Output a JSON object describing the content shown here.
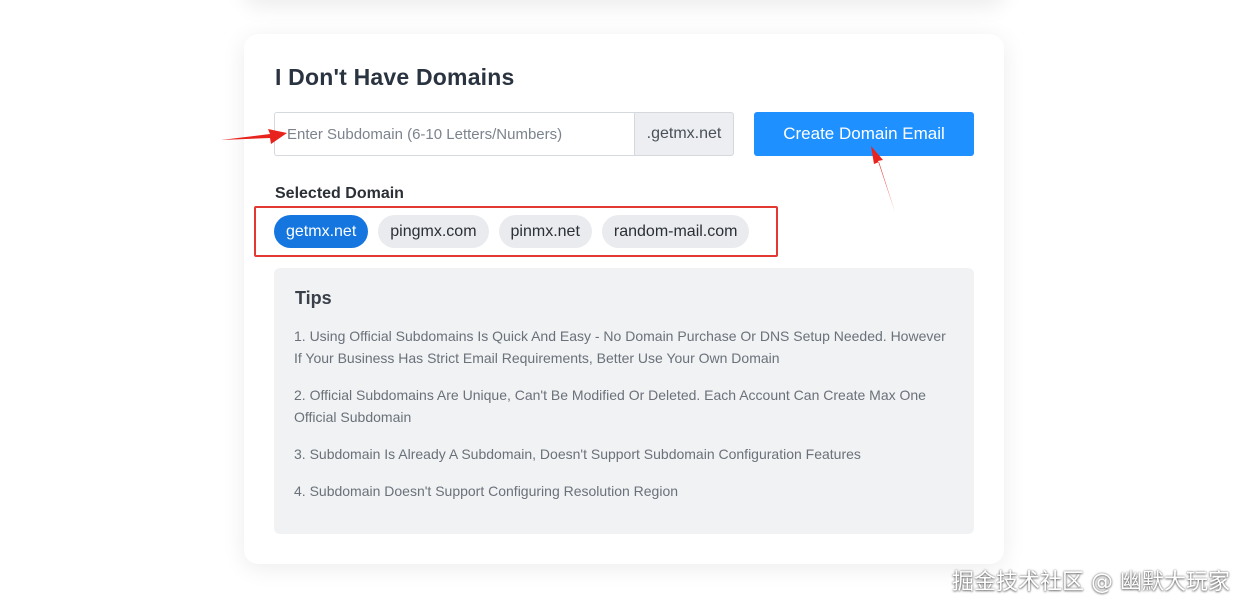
{
  "section": {
    "title": "I Don't Have Domains"
  },
  "subdomain_input": {
    "placeholder": "Enter Subdomain (6-10 Letters/Numbers)",
    "value": "",
    "suffix": ".getmx.net"
  },
  "create_button": {
    "label": "Create Domain Email"
  },
  "selected_domain": {
    "label": "Selected Domain",
    "options": [
      {
        "label": "getmx.net",
        "selected": true
      },
      {
        "label": "pingmx.com",
        "selected": false
      },
      {
        "label": "pinmx.net",
        "selected": false
      },
      {
        "label": "random-mail.com",
        "selected": false
      }
    ]
  },
  "tips": {
    "title": "Tips",
    "items": [
      "1. Using Official Subdomains Is Quick And Easy - No Domain Purchase Or DNS Setup Needed. However If Your Business Has Strict Email Requirements, Better Use Your Own Domain",
      "2. Official Subdomains Are Unique, Can't Be Modified Or Deleted. Each Account Can Create Max One Official Subdomain",
      "3. Subdomain Is Already A Subdomain, Doesn't Support Subdomain Configuration Features",
      "4. Subdomain Doesn't Support Configuring Resolution Region"
    ]
  },
  "watermark": {
    "text": "掘金技术社区 @ 幽默大玩家"
  },
  "colors": {
    "primary": "#1e90ff",
    "chip_active": "#1576e0",
    "annotation_red": "#e23a33",
    "tips_bg": "#f0f2f4"
  }
}
